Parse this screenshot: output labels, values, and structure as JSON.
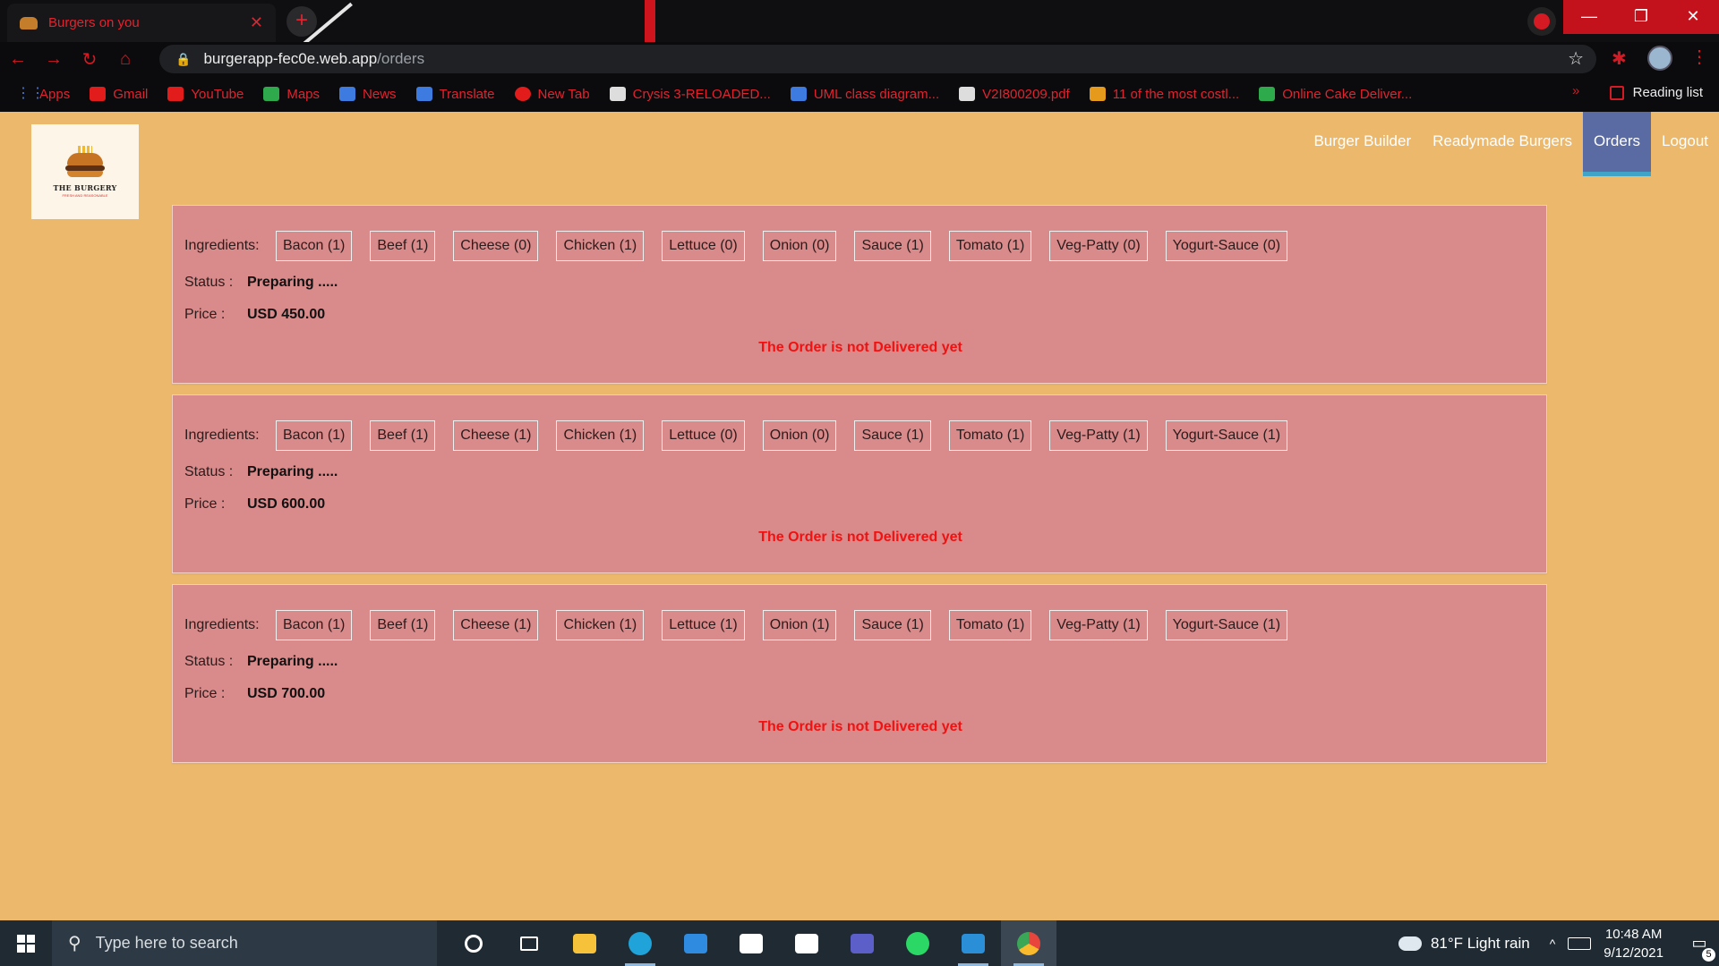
{
  "browser": {
    "tab_title": "Burgers on you",
    "tab_close": "✕",
    "new_tab": "+",
    "url_host": "burgerapp-fec0e.web.app",
    "url_path": "/orders",
    "window_buttons": [
      "—",
      "❐",
      "✕"
    ],
    "bookmarks": [
      {
        "label": "Apps",
        "icon": "apps-icon"
      },
      {
        "label": "Gmail",
        "icon": "gmail-icon"
      },
      {
        "label": "YouTube",
        "icon": "youtube-icon"
      },
      {
        "label": "Maps",
        "icon": "maps-icon"
      },
      {
        "label": "News",
        "icon": "news-icon"
      },
      {
        "label": "Translate",
        "icon": "translate-icon"
      },
      {
        "label": "New Tab",
        "icon": "newtab-icon"
      },
      {
        "label": "Crysis 3-RELOADED...",
        "icon": "crysis-icon"
      },
      {
        "label": "UML class diagram...",
        "icon": "uml-icon"
      },
      {
        "label": "V2I800209.pdf",
        "icon": "pdf-icon"
      },
      {
        "label": "11 of the most costl...",
        "icon": "article-icon"
      },
      {
        "label": "Online Cake Deliver...",
        "icon": "cake-icon"
      }
    ],
    "reading_list": "Reading list",
    "more": "»"
  },
  "app": {
    "logo_name": "THE BURGERY",
    "logo_tagline": "FRESH AND REASONABLE",
    "nav": [
      {
        "label": "Burger Builder",
        "active": false
      },
      {
        "label": "Readymade Burgers",
        "active": false
      },
      {
        "label": "Orders",
        "active": true
      },
      {
        "label": "Logout",
        "active": false
      }
    ],
    "ingredients_label": "Ingredients:",
    "status_label": "Status :",
    "price_label": "Price :",
    "orders": [
      {
        "ingredients": [
          "Bacon (1)",
          "Beef (1)",
          "Cheese (0)",
          "Chicken (1)",
          "Lettuce (0)",
          "Onion (0)",
          "Sauce (1)",
          "Tomato (1)",
          "Veg-Patty (0)",
          "Yogurt-Sauce (0)"
        ],
        "status": "Preparing .....",
        "price": "USD 450.00",
        "delivery": "The Order is not Delivered yet"
      },
      {
        "ingredients": [
          "Bacon (1)",
          "Beef (1)",
          "Cheese (1)",
          "Chicken (1)",
          "Lettuce (0)",
          "Onion (0)",
          "Sauce (1)",
          "Tomato (1)",
          "Veg-Patty (1)",
          "Yogurt-Sauce (1)"
        ],
        "status": "Preparing .....",
        "price": "USD 600.00",
        "delivery": "The Order is not Delivered yet"
      },
      {
        "ingredients": [
          "Bacon (1)",
          "Beef (1)",
          "Cheese (1)",
          "Chicken (1)",
          "Lettuce (1)",
          "Onion (1)",
          "Sauce (1)",
          "Tomato (1)",
          "Veg-Patty (1)",
          "Yogurt-Sauce (1)"
        ],
        "status": "Preparing .....",
        "price": "USD 700.00",
        "delivery": "The Order is not Delivered yet"
      }
    ]
  },
  "taskbar": {
    "search_placeholder": "Type here to search",
    "apps": [
      {
        "name": "cortana-icon",
        "color": "#ffffff"
      },
      {
        "name": "task-view-icon",
        "color": "#ffffff"
      },
      {
        "name": "file-explorer-icon",
        "color": "#f5c23a"
      },
      {
        "name": "edge-icon",
        "color": "#1fa3d9"
      },
      {
        "name": "mail-icon",
        "color": "#2f8be0"
      },
      {
        "name": "store-icon",
        "color": "#ffffff"
      },
      {
        "name": "amazon-icon",
        "color": "#ffffff"
      },
      {
        "name": "teams-icon",
        "color": "#5b5fc7"
      },
      {
        "name": "whatsapp-icon",
        "color": "#2bd865"
      },
      {
        "name": "vscode-icon",
        "color": "#2b8fd8"
      },
      {
        "name": "chrome-icon",
        "color": "#e8453c"
      }
    ],
    "weather": "81°F  Light rain",
    "time": "10:48 AM",
    "date": "9/12/2021",
    "notifications": "5"
  }
}
